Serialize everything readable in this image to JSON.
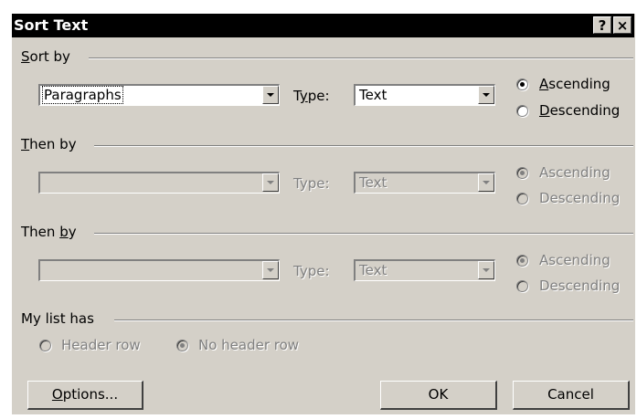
{
  "window": {
    "title": "Sort Text",
    "help_label": "?",
    "close_label": "×"
  },
  "sort_by": {
    "group_label_mn": "S",
    "group_label_rest": "ort by",
    "field_value": "Paragraphs",
    "type_label_pre": "T",
    "type_label_mn": "y",
    "type_label_post": "pe:",
    "type_value": "Text",
    "ascending_mn": "A",
    "ascending_rest": "scending",
    "descending_mn": "D",
    "descending_rest": "escending",
    "selected": "ascending"
  },
  "then_by_1": {
    "group_label_mn": "T",
    "group_label_rest": "hen by",
    "field_value": "",
    "type_label": "Type:",
    "type_value": "Text",
    "ascending": "Ascending",
    "descending": "Descending",
    "selected": "ascending"
  },
  "then_by_2": {
    "group_label_pre": "Then ",
    "group_label_mn": "b",
    "group_label_rest": "y",
    "field_value": "",
    "type_label": "Type:",
    "type_value": "Text",
    "ascending": "Ascending",
    "descending": "Descending",
    "selected": "ascending"
  },
  "my_list_has": {
    "group_label": "My list has",
    "header_row": "Header row",
    "no_header_row": "No header row",
    "selected": "no_header_row"
  },
  "buttons": {
    "options_mn": "O",
    "options_rest": "ptions...",
    "ok": "OK",
    "cancel": "Cancel"
  }
}
